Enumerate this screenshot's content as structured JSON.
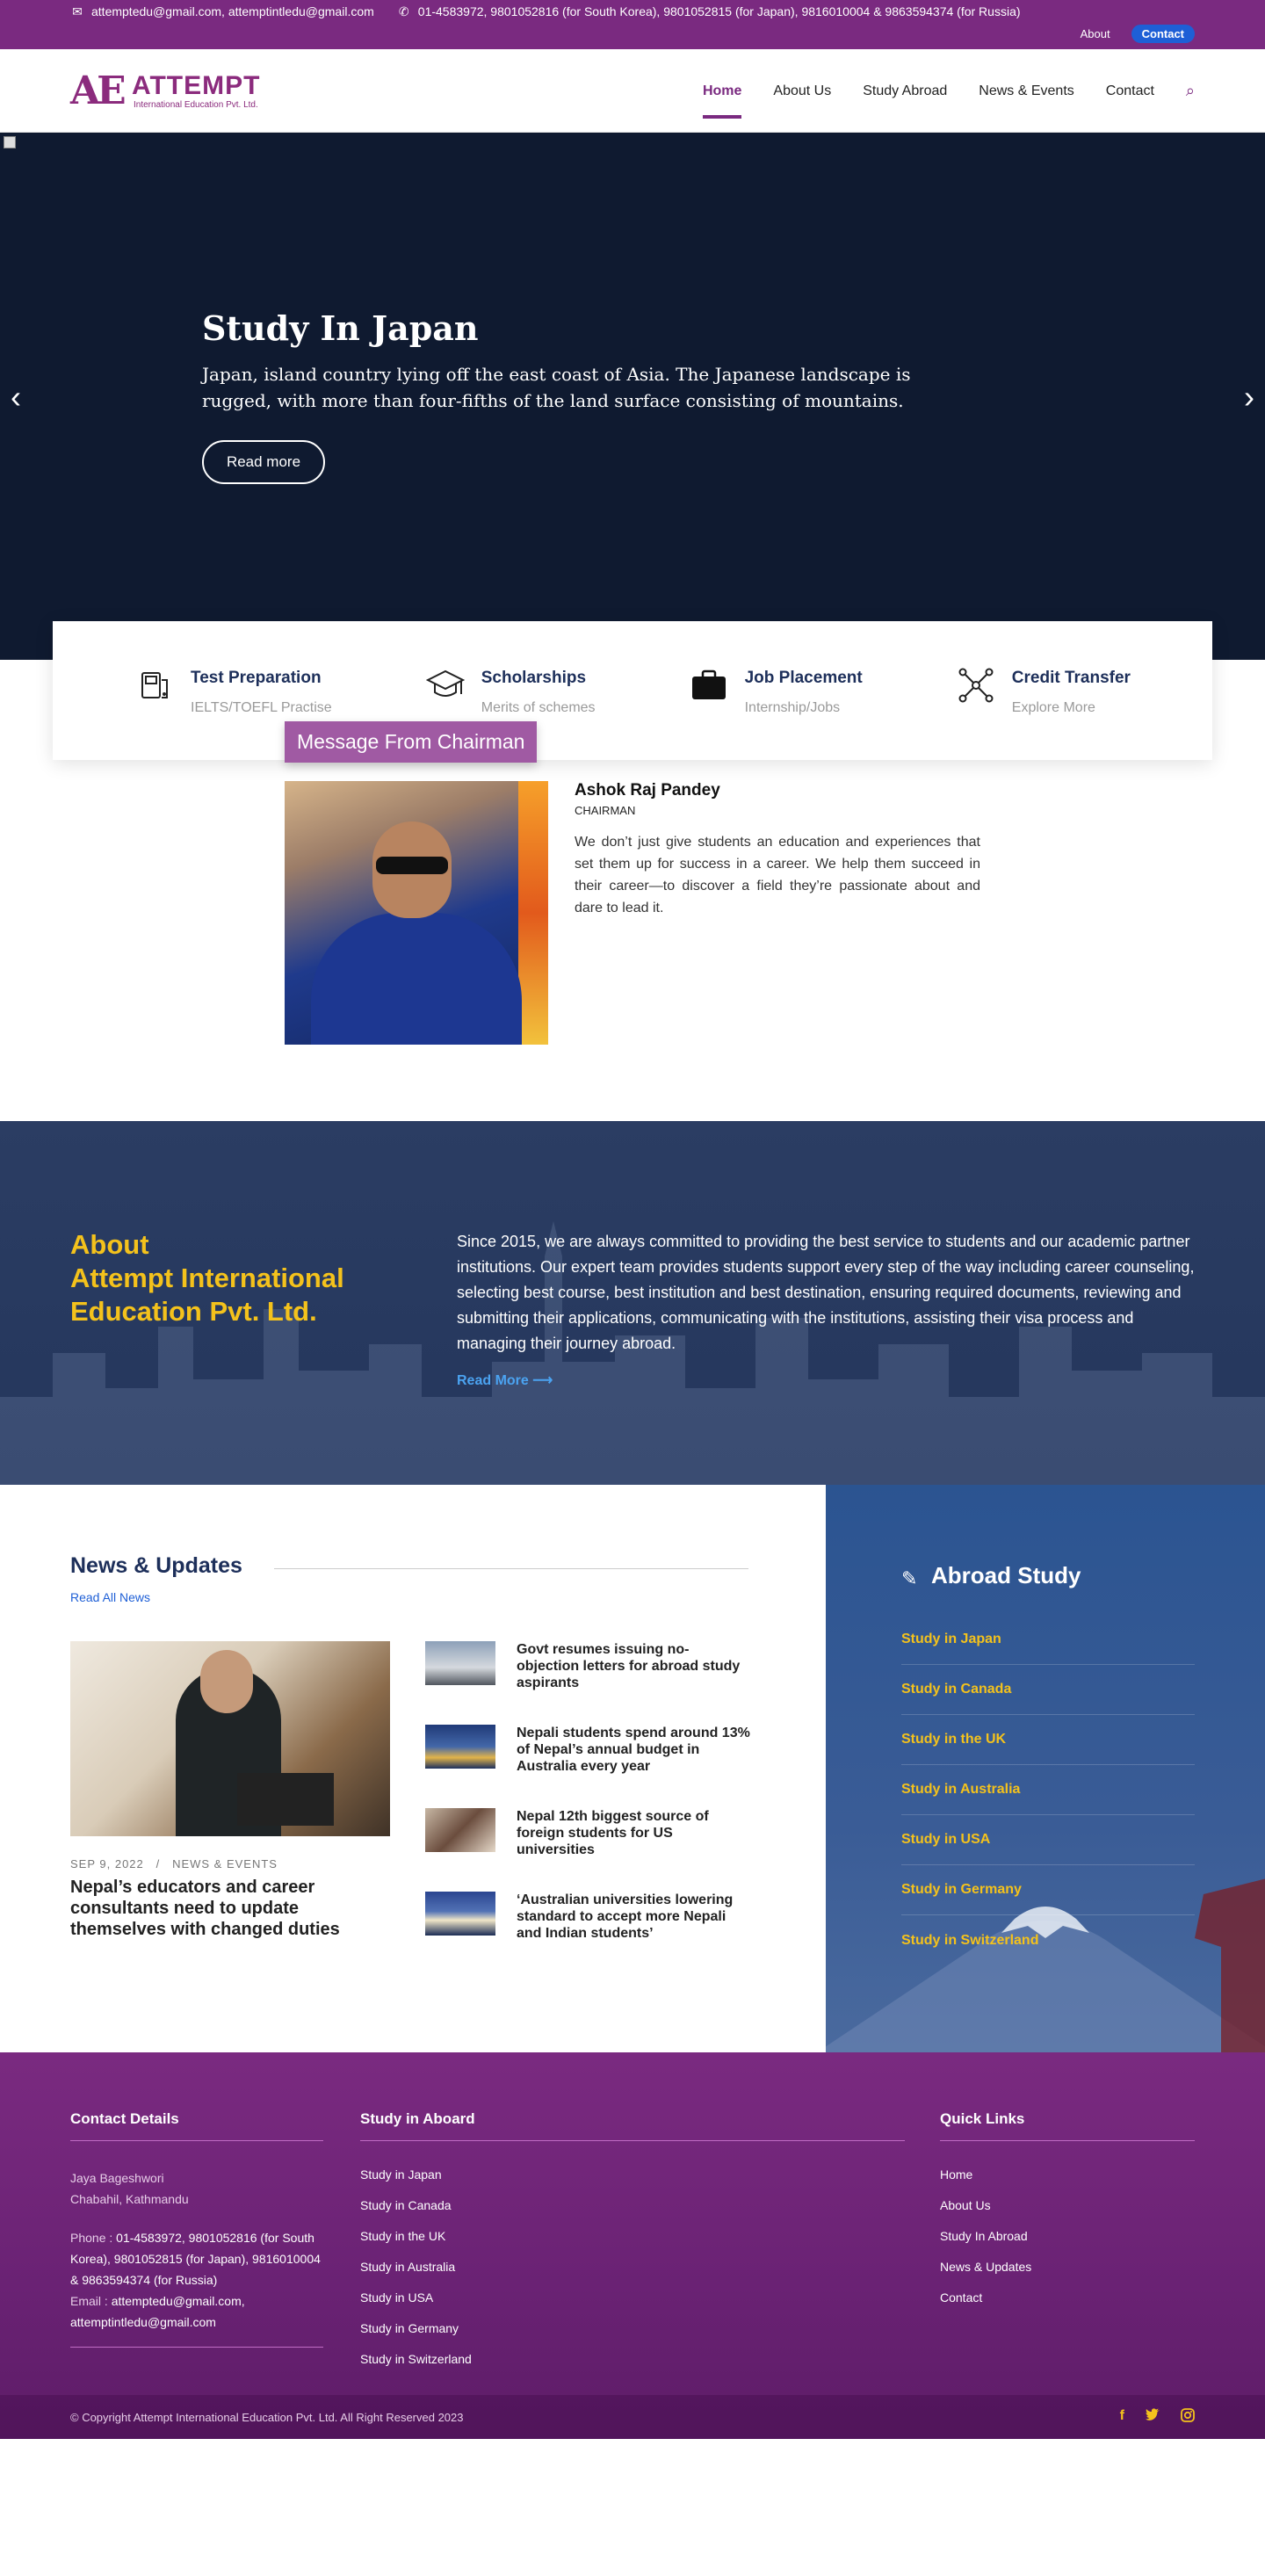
{
  "topbar": {
    "email": "attemptedu@gmail.com, attemptintledu@gmail.com",
    "phone": "01-4583972, 9801052816 (for South Korea), 9801052815 (for Japan), 9816010004 & 9863594374 (for Russia)",
    "about_link": "About",
    "contact_button": "Contact"
  },
  "header": {
    "logo_mark": "AE",
    "logo_word": "ATTEMPT",
    "logo_sub": "International Education Pvt. Ltd.",
    "nav": [
      {
        "label": "Home",
        "active": true
      },
      {
        "label": "About Us"
      },
      {
        "label": "Study Abroad"
      },
      {
        "label": "News & Events"
      },
      {
        "label": "Contact"
      }
    ]
  },
  "hero": {
    "title": "Study In Japan",
    "text": "Japan, island country lying off the east coast of Asia. The Japanese landscape is rugged, with more than four-fifths of the land surface consisting of mountains.",
    "button": "Read more"
  },
  "features": [
    {
      "title": "Test Preparation",
      "sub": "IELTS/TOEFL Practise",
      "icon": "pen-book-icon"
    },
    {
      "title": "Scholarships",
      "sub": "Merits of schemes",
      "icon": "graduation-cap-icon"
    },
    {
      "title": "Job Placement",
      "sub": "Internship/Jobs",
      "icon": "briefcase-icon"
    },
    {
      "title": "Credit Transfer",
      "sub": "Explore More",
      "icon": "network-icon"
    }
  ],
  "chairman": {
    "label": "Message From Chairman",
    "name": "Ashok Raj Pandey",
    "role": "CHAIRMAN",
    "message": "We don’t just give students an education and experiences that set them up for success in a career. We help them succeed in their career—to discover a field they’re passionate about and dare to lead it."
  },
  "about": {
    "heading_line1": "About",
    "heading_line2": "Attempt International",
    "heading_line3": "Education Pvt. Ltd.",
    "text": "Since 2015, we are always committed to providing the best service to students and our academic partner institutions. Our expert team provides students support every step of the way including career counseling, selecting best course, best institution and best destination, ensuring required documents, reviewing and submitting their applications, communicating with the institutions, assisting their visa process and managing their journey abroad.",
    "read_more": "Read More"
  },
  "news": {
    "heading": "News & Updates",
    "all_link": "Read All News",
    "featured": {
      "date": "SEP 9, 2022",
      "category": "NEWS & EVENTS",
      "title": "Nepal’s educators and career consultants need to update themselves with changed duties"
    },
    "items": [
      {
        "title": "Govt resumes issuing no-objection letters for abroad study aspirants"
      },
      {
        "title": "Nepali students spend around 13% of Nepal’s annual budget in Australia every year"
      },
      {
        "title": "Nepal 12th biggest source of foreign students for US universities"
      },
      {
        "title": "‘Australian universities lowering standard to accept more Nepali and Indian students’"
      }
    ]
  },
  "abroad": {
    "heading": "Abroad Study",
    "items": [
      "Study in Japan",
      "Study in Canada",
      "Study in the UK",
      "Study in Australia",
      "Study in USA",
      "Study in Germany",
      "Study in Switzerland"
    ]
  },
  "footer": {
    "contact_heading": "Contact Details",
    "address_line1": "Jaya Bageshwori",
    "address_line2": "Chabahil, Kathmandu",
    "phone_label": "Phone :",
    "phone": "01-4583972, 9801052816 (for South Korea), 9801052815 (for Japan), 9816010004 & 9863594374 (for Russia)",
    "email_label": "Email :",
    "email": "attemptedu@gmail.com, attemptintledu@gmail.com",
    "study_heading": "Study in Aboard",
    "study_items": [
      "Study in Japan",
      "Study in Canada",
      "Study in the UK",
      "Study in Australia",
      "Study in USA",
      "Study in Germany",
      "Study in Switzerland"
    ],
    "quick_heading": "Quick Links",
    "quick_items": [
      "Home",
      "About Us",
      "Study In Abroad",
      "News & Updates",
      "Contact"
    ],
    "copyright": "© Copyright Attempt International Education Pvt. Ltd. All Right Reserved 2023"
  }
}
